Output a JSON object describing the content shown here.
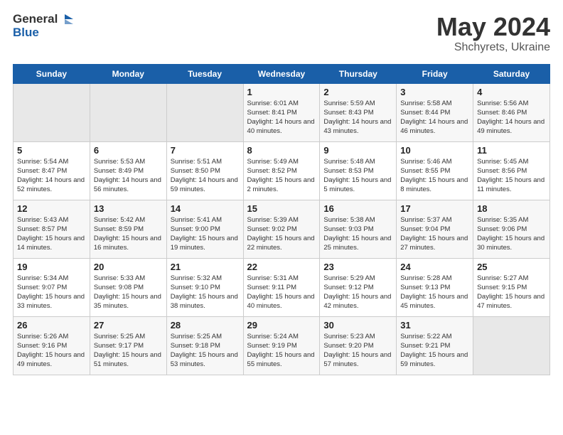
{
  "logo": {
    "text_general": "General",
    "text_blue": "Blue"
  },
  "header": {
    "month_year": "May 2024",
    "location": "Shchyrets, Ukraine"
  },
  "weekdays": [
    "Sunday",
    "Monday",
    "Tuesday",
    "Wednesday",
    "Thursday",
    "Friday",
    "Saturday"
  ],
  "weeks": [
    [
      {
        "day": "",
        "sunrise": "",
        "sunset": "",
        "daylight": ""
      },
      {
        "day": "",
        "sunrise": "",
        "sunset": "",
        "daylight": ""
      },
      {
        "day": "",
        "sunrise": "",
        "sunset": "",
        "daylight": ""
      },
      {
        "day": "1",
        "sunrise": "Sunrise: 6:01 AM",
        "sunset": "Sunset: 8:41 PM",
        "daylight": "Daylight: 14 hours and 40 minutes."
      },
      {
        "day": "2",
        "sunrise": "Sunrise: 5:59 AM",
        "sunset": "Sunset: 8:43 PM",
        "daylight": "Daylight: 14 hours and 43 minutes."
      },
      {
        "day": "3",
        "sunrise": "Sunrise: 5:58 AM",
        "sunset": "Sunset: 8:44 PM",
        "daylight": "Daylight: 14 hours and 46 minutes."
      },
      {
        "day": "4",
        "sunrise": "Sunrise: 5:56 AM",
        "sunset": "Sunset: 8:46 PM",
        "daylight": "Daylight: 14 hours and 49 minutes."
      }
    ],
    [
      {
        "day": "5",
        "sunrise": "Sunrise: 5:54 AM",
        "sunset": "Sunset: 8:47 PM",
        "daylight": "Daylight: 14 hours and 52 minutes."
      },
      {
        "day": "6",
        "sunrise": "Sunrise: 5:53 AM",
        "sunset": "Sunset: 8:49 PM",
        "daylight": "Daylight: 14 hours and 56 minutes."
      },
      {
        "day": "7",
        "sunrise": "Sunrise: 5:51 AM",
        "sunset": "Sunset: 8:50 PM",
        "daylight": "Daylight: 14 hours and 59 minutes."
      },
      {
        "day": "8",
        "sunrise": "Sunrise: 5:49 AM",
        "sunset": "Sunset: 8:52 PM",
        "daylight": "Daylight: 15 hours and 2 minutes."
      },
      {
        "day": "9",
        "sunrise": "Sunrise: 5:48 AM",
        "sunset": "Sunset: 8:53 PM",
        "daylight": "Daylight: 15 hours and 5 minutes."
      },
      {
        "day": "10",
        "sunrise": "Sunrise: 5:46 AM",
        "sunset": "Sunset: 8:55 PM",
        "daylight": "Daylight: 15 hours and 8 minutes."
      },
      {
        "day": "11",
        "sunrise": "Sunrise: 5:45 AM",
        "sunset": "Sunset: 8:56 PM",
        "daylight": "Daylight: 15 hours and 11 minutes."
      }
    ],
    [
      {
        "day": "12",
        "sunrise": "Sunrise: 5:43 AM",
        "sunset": "Sunset: 8:57 PM",
        "daylight": "Daylight: 15 hours and 14 minutes."
      },
      {
        "day": "13",
        "sunrise": "Sunrise: 5:42 AM",
        "sunset": "Sunset: 8:59 PM",
        "daylight": "Daylight: 15 hours and 16 minutes."
      },
      {
        "day": "14",
        "sunrise": "Sunrise: 5:41 AM",
        "sunset": "Sunset: 9:00 PM",
        "daylight": "Daylight: 15 hours and 19 minutes."
      },
      {
        "day": "15",
        "sunrise": "Sunrise: 5:39 AM",
        "sunset": "Sunset: 9:02 PM",
        "daylight": "Daylight: 15 hours and 22 minutes."
      },
      {
        "day": "16",
        "sunrise": "Sunrise: 5:38 AM",
        "sunset": "Sunset: 9:03 PM",
        "daylight": "Daylight: 15 hours and 25 minutes."
      },
      {
        "day": "17",
        "sunrise": "Sunrise: 5:37 AM",
        "sunset": "Sunset: 9:04 PM",
        "daylight": "Daylight: 15 hours and 27 minutes."
      },
      {
        "day": "18",
        "sunrise": "Sunrise: 5:35 AM",
        "sunset": "Sunset: 9:06 PM",
        "daylight": "Daylight: 15 hours and 30 minutes."
      }
    ],
    [
      {
        "day": "19",
        "sunrise": "Sunrise: 5:34 AM",
        "sunset": "Sunset: 9:07 PM",
        "daylight": "Daylight: 15 hours and 33 minutes."
      },
      {
        "day": "20",
        "sunrise": "Sunrise: 5:33 AM",
        "sunset": "Sunset: 9:08 PM",
        "daylight": "Daylight: 15 hours and 35 minutes."
      },
      {
        "day": "21",
        "sunrise": "Sunrise: 5:32 AM",
        "sunset": "Sunset: 9:10 PM",
        "daylight": "Daylight: 15 hours and 38 minutes."
      },
      {
        "day": "22",
        "sunrise": "Sunrise: 5:31 AM",
        "sunset": "Sunset: 9:11 PM",
        "daylight": "Daylight: 15 hours and 40 minutes."
      },
      {
        "day": "23",
        "sunrise": "Sunrise: 5:29 AM",
        "sunset": "Sunset: 9:12 PM",
        "daylight": "Daylight: 15 hours and 42 minutes."
      },
      {
        "day": "24",
        "sunrise": "Sunrise: 5:28 AM",
        "sunset": "Sunset: 9:13 PM",
        "daylight": "Daylight: 15 hours and 45 minutes."
      },
      {
        "day": "25",
        "sunrise": "Sunrise: 5:27 AM",
        "sunset": "Sunset: 9:15 PM",
        "daylight": "Daylight: 15 hours and 47 minutes."
      }
    ],
    [
      {
        "day": "26",
        "sunrise": "Sunrise: 5:26 AM",
        "sunset": "Sunset: 9:16 PM",
        "daylight": "Daylight: 15 hours and 49 minutes."
      },
      {
        "day": "27",
        "sunrise": "Sunrise: 5:25 AM",
        "sunset": "Sunset: 9:17 PM",
        "daylight": "Daylight: 15 hours and 51 minutes."
      },
      {
        "day": "28",
        "sunrise": "Sunrise: 5:25 AM",
        "sunset": "Sunset: 9:18 PM",
        "daylight": "Daylight: 15 hours and 53 minutes."
      },
      {
        "day": "29",
        "sunrise": "Sunrise: 5:24 AM",
        "sunset": "Sunset: 9:19 PM",
        "daylight": "Daylight: 15 hours and 55 minutes."
      },
      {
        "day": "30",
        "sunrise": "Sunrise: 5:23 AM",
        "sunset": "Sunset: 9:20 PM",
        "daylight": "Daylight: 15 hours and 57 minutes."
      },
      {
        "day": "31",
        "sunrise": "Sunrise: 5:22 AM",
        "sunset": "Sunset: 9:21 PM",
        "daylight": "Daylight: 15 hours and 59 minutes."
      },
      {
        "day": "",
        "sunrise": "",
        "sunset": "",
        "daylight": ""
      }
    ]
  ]
}
